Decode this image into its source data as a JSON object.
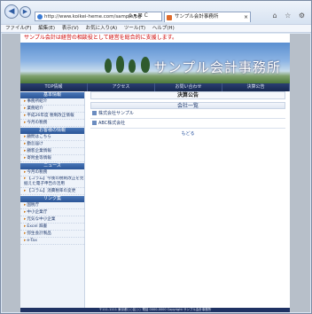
{
  "browser": {
    "address": "http://www.koikei-heme.com/sample/pg",
    "address_tools": "ρ ▾ ⊠ C",
    "tab_title": "サンプル会計事務所",
    "tab_close": "×",
    "toolbar_icons": "⌂ ☆ ⚙"
  },
  "menu": [
    "ファイル(F)",
    "編集(E)",
    "表示(V)",
    "お気に入り(A)",
    "ツール(T)",
    "ヘルプ(H)"
  ],
  "site": {
    "tagline": "サンプル会計は経営の相談役として経営を総合的に支援します。",
    "name": "サンプル会計事務所",
    "gnav": [
      "TOP情報",
      "アクセス",
      "お問い合わせ",
      "決算公告"
    ]
  },
  "sidebar": {
    "sections": [
      {
        "title": "基本情報",
        "items": [
          "事務所紹介",
          "業務紹介",
          "平成26年度 税制改正情報",
          "今月の税務"
        ]
      },
      {
        "title": "お客様の情報",
        "items": [
          "顧問はこちら",
          "勤怠届け",
          "顧客企業情報",
          "寄附金等情報"
        ]
      },
      {
        "title": "ニュース",
        "items": [
          "今月の税務",
          "【コラム】今後の税制改正を見据えた電子申告の活用",
          "【コラム】消費税率の変更"
        ]
      },
      {
        "title": "リンク集",
        "items": [
          "国税庁",
          "中小企業庁",
          "元気な中小企業",
          "Excel 辞書",
          "弥生会計製品",
          "e-Tax"
        ]
      }
    ]
  },
  "main": {
    "page_title": "決算公告",
    "section_title": "会社一覧",
    "notices": [
      "株式会社サンプル",
      "ABC株式会社"
    ],
    "more": "もどる"
  },
  "footer": "〒111-1111 東京都○○区○○ 電話 0000-0000 Copyright サンプル会計事務所"
}
